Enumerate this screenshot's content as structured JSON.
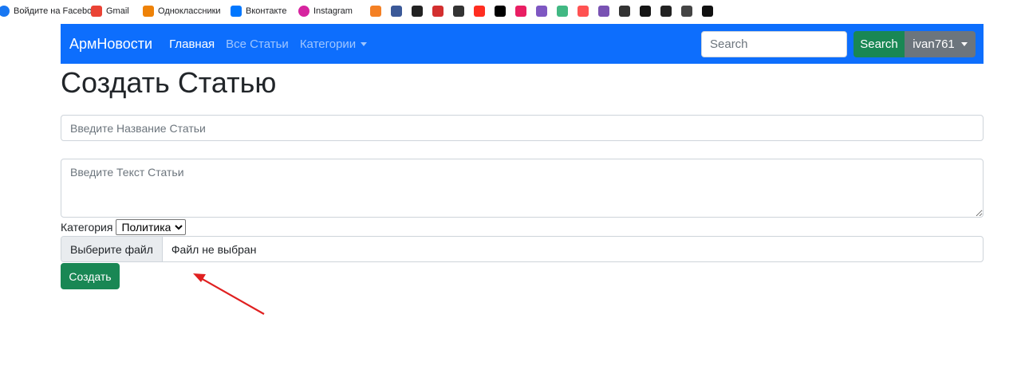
{
  "bookmarks": [
    {
      "label": "Войдите на Facebo...",
      "icon": "facebook-icon",
      "color": "#1877f2"
    },
    {
      "label": "Gmail",
      "icon": "gmail-icon",
      "color": "#ea4335"
    },
    {
      "label": "Одноклассники",
      "icon": "odnoklassniki-icon",
      "color": "#ee8208"
    },
    {
      "label": "Вконтакте",
      "icon": "vk-icon",
      "color": "#0077ff"
    },
    {
      "label": "Instagram",
      "icon": "instagram-icon",
      "color": "#d6249f"
    }
  ],
  "icon_bookmarks": [
    {
      "icon": "stackoverflow-icon",
      "color": "#f48024"
    },
    {
      "icon": "msb-icon",
      "color": "#3b5998"
    },
    {
      "icon": "bookmark-dark-icon",
      "color": "#222222"
    },
    {
      "icon": "repo-icon",
      "color": "#d32f2f"
    },
    {
      "icon": "square-icon",
      "color": "#333333"
    },
    {
      "icon": "laravel-icon",
      "color": "#ff2d20"
    },
    {
      "icon": "dev-icon",
      "color": "#000000"
    },
    {
      "icon": "pink-circle-icon",
      "color": "#e91e63"
    },
    {
      "icon": "flag-icon",
      "color": "#7e57c2"
    },
    {
      "icon": "vue-icon",
      "color": "#41b883"
    },
    {
      "icon": "codepen-red-icon",
      "color": "#ff5252"
    },
    {
      "icon": "bootstrap-icon",
      "color": "#7952b3"
    },
    {
      "icon": "globe-icon",
      "color": "#333333"
    },
    {
      "icon": "codesandbox-icon",
      "color": "#151515"
    },
    {
      "icon": "bc-icon",
      "color": "#222222"
    },
    {
      "icon": "telegram-icon",
      "color": "#444444"
    },
    {
      "icon": "k-icon",
      "color": "#111111"
    }
  ],
  "navbar": {
    "brand": "АрмНовости",
    "links": [
      "Главная",
      "Все Статьи",
      "Категории"
    ],
    "search_placeholder": "Search",
    "search_button": "Search",
    "user": "ivan761",
    "color": "#0d6efd"
  },
  "form": {
    "title": "Создать Статью",
    "title_placeholder": "Введите Название Статьи",
    "text_placeholder": "Введите Текст Статьи",
    "category_label": "Категория",
    "category_value": "Политика",
    "file_button": "Выберите файл",
    "file_status": "Файл не выбран",
    "submit": "Создать"
  },
  "annotation_arrow": {
    "color": "#e02020"
  }
}
